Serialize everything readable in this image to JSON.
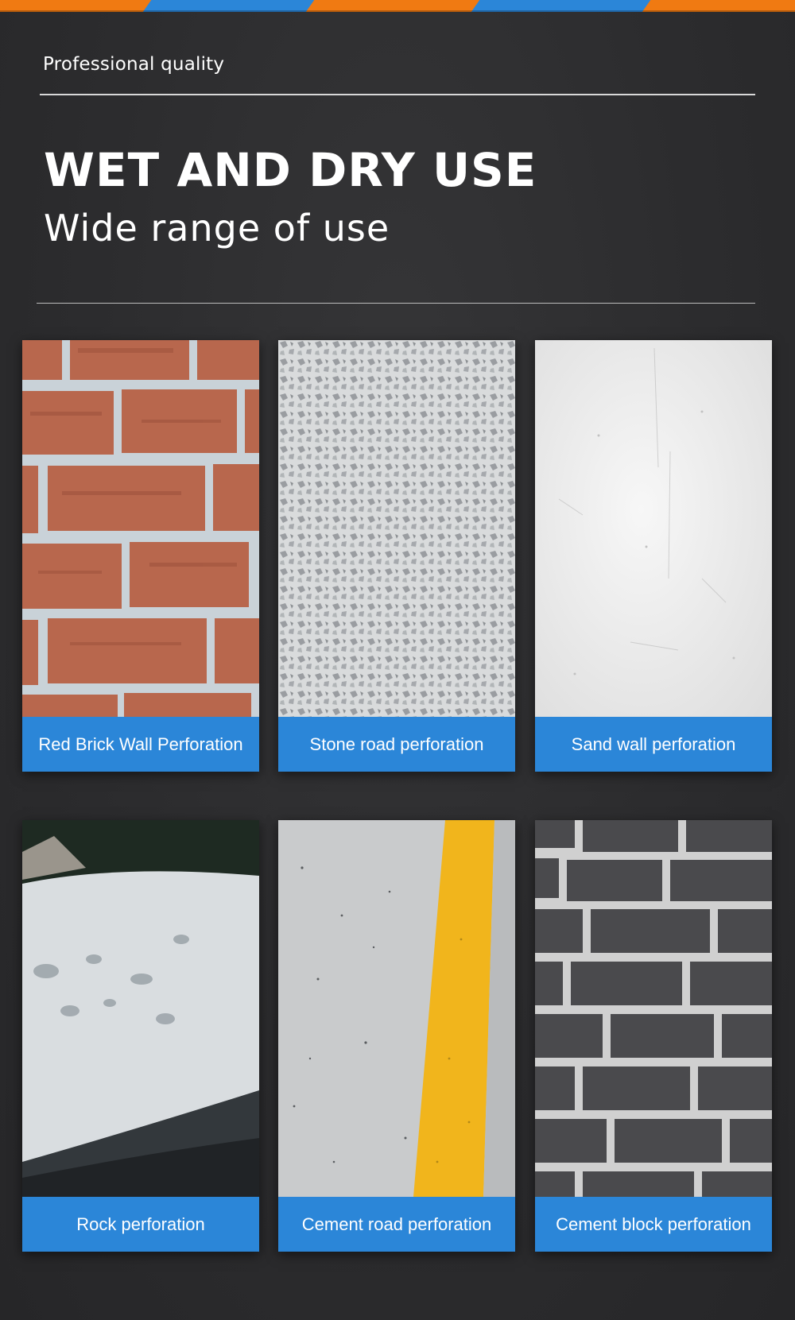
{
  "header": {
    "tagline": "Professional quality",
    "title": "WET AND DRY USE",
    "subtitle": "Wide range of use"
  },
  "colors": {
    "background": "#2d2d2f",
    "accent_orange": "#f07a12",
    "accent_blue": "#2b86d8",
    "text": "#ffffff"
  },
  "cards": [
    {
      "label": "Red Brick Wall Perforation",
      "image": "red-brick-wall-photo"
    },
    {
      "label": "Stone road perforation",
      "image": "stone-road-photo"
    },
    {
      "label": "Sand wall perforation",
      "image": "sand-wall-photo"
    },
    {
      "label": "Rock perforation",
      "image": "rock-photo"
    },
    {
      "label": "Cement road perforation",
      "image": "cement-road-photo"
    },
    {
      "label": "Cement block perforation",
      "image": "cement-block-photo"
    }
  ]
}
